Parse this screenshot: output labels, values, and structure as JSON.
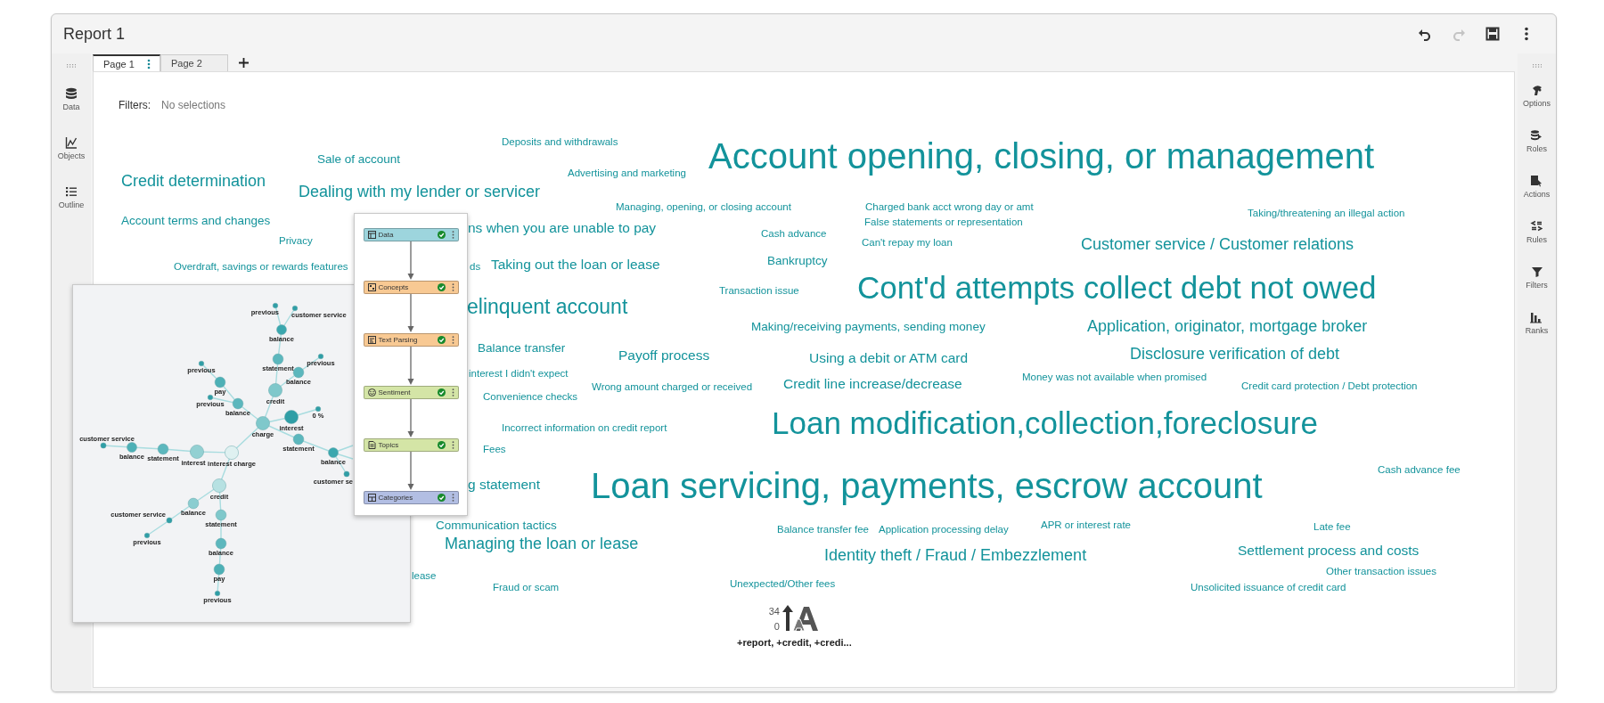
{
  "window": {
    "title": "Report 1"
  },
  "toolbar": [
    {
      "kind": "undo",
      "disabled": false
    },
    {
      "kind": "redo",
      "disabled": true
    },
    {
      "kind": "save",
      "disabled": false
    },
    {
      "kind": "more",
      "disabled": false
    }
  ],
  "left_sidebar": [
    {
      "kind": "data",
      "label": "Data"
    },
    {
      "kind": "objects",
      "label": "Objects"
    },
    {
      "kind": "outline",
      "label": "Outline"
    }
  ],
  "right_sidebar": [
    {
      "kind": "options",
      "label": "Options"
    },
    {
      "kind": "roles",
      "label": "Roles"
    },
    {
      "kind": "actions",
      "label": "Actions"
    },
    {
      "kind": "rules",
      "label": "Rules"
    },
    {
      "kind": "filters",
      "label": "Filters"
    },
    {
      "kind": "ranks",
      "label": "Ranks"
    }
  ],
  "tabs": [
    {
      "label": "Page 1",
      "selected": true
    },
    {
      "label": "Page 2",
      "selected": false
    }
  ],
  "filters": {
    "label": "Filters:",
    "value": "No selections"
  },
  "word_cloud": {
    "words": [
      {
        "text": "Deposits and withdrawals",
        "kind": "xs"
      },
      {
        "text": "Sale of account",
        "kind": "s"
      },
      {
        "text": "Advertising and marketing",
        "kind": "xs"
      },
      {
        "text": "Credit determination",
        "kind": "ml"
      },
      {
        "text": "Account opening, closing, or management",
        "kind": "xxl"
      },
      {
        "text": "Dealing with my lender or servicer",
        "kind": "ml"
      },
      {
        "text": "Managing, opening, or closing account",
        "kind": "xs"
      },
      {
        "text": "Charged bank acct wrong day or amt",
        "kind": "xs"
      },
      {
        "text": "Account terms and changes",
        "kind": "s"
      },
      {
        "text": "ns when you are unable to pay",
        "kind": "m"
      },
      {
        "text": "False statements or representation",
        "kind": "xs"
      },
      {
        "text": "Taking/threatening an illegal action",
        "kind": "xs"
      },
      {
        "text": "Privacy",
        "kind": "xs"
      },
      {
        "text": "Cash advance",
        "kind": "xs"
      },
      {
        "text": "Can't repay my loan",
        "kind": "xs"
      },
      {
        "text": "Customer service / Customer relations",
        "kind": "ml"
      },
      {
        "text": "Overdraft, savings or rewards features",
        "kind": "xs"
      },
      {
        "text": "ds",
        "kind": "xs"
      },
      {
        "text": "Taking out the loan or lease",
        "kind": "m"
      },
      {
        "text": "Bankruptcy",
        "kind": "s"
      },
      {
        "text": "Transaction issue",
        "kind": "xs"
      },
      {
        "text": "elinquent account",
        "kind": "l"
      },
      {
        "text": "Cont'd attempts collect debt not owed",
        "kind": "xl"
      },
      {
        "text": "Making/receiving payments, sending money",
        "kind": "s"
      },
      {
        "text": "Application, originator, mortgage broker",
        "kind": "ml"
      },
      {
        "text": "Balance transfer",
        "kind": "s"
      },
      {
        "text": "Payoff process",
        "kind": "m"
      },
      {
        "text": "Using a debit or ATM card",
        "kind": "m"
      },
      {
        "text": "Disclosure verification of debt",
        "kind": "ml"
      },
      {
        "text": "interest I didn't expect",
        "kind": "xs"
      },
      {
        "text": "Wrong amount charged or received",
        "kind": "xs"
      },
      {
        "text": "Credit line increase/decrease",
        "kind": "m"
      },
      {
        "text": "Money was not available when promised",
        "kind": "xs"
      },
      {
        "text": "Credit card protection / Debt protection",
        "kind": "xs"
      },
      {
        "text": "Convenience checks",
        "kind": "xs"
      },
      {
        "text": "Incorrect information on credit report",
        "kind": "xs"
      },
      {
        "text": "Loan modification,collection,foreclosure",
        "kind": "xl"
      },
      {
        "text": "Fees",
        "kind": "xs"
      },
      {
        "text": "g statement",
        "kind": "m"
      },
      {
        "text": "Loan servicing, payments, escrow account",
        "kind": "xxl"
      },
      {
        "text": "Cash advance fee",
        "kind": "xs"
      },
      {
        "text": "Communication tactics",
        "kind": "s"
      },
      {
        "text": "Balance transfer fee",
        "kind": "xs"
      },
      {
        "text": "Application processing delay",
        "kind": "xs"
      },
      {
        "text": "APR or interest rate",
        "kind": "xs"
      },
      {
        "text": "Late fee",
        "kind": "xs"
      },
      {
        "text": "Managing the loan or lease",
        "kind": "ml"
      },
      {
        "text": "Identity theft / Fraud / Embezzlement",
        "kind": "ml"
      },
      {
        "text": "Settlement process and costs",
        "kind": "m"
      },
      {
        "text": "lease",
        "kind": "xs"
      },
      {
        "text": "Fraud or scam",
        "kind": "xs"
      },
      {
        "text": "Unexpected/Other fees",
        "kind": "xs"
      },
      {
        "text": "Unsolicited issuance of credit card",
        "kind": "xs"
      },
      {
        "text": "Other transaction issues",
        "kind": "xs"
      }
    ],
    "legend": {
      "max": "34",
      "min": "0",
      "caption": "+report, +credit, +credi..."
    }
  },
  "graph": {
    "nodes": [
      {
        "label": "previous",
        "color": "#2f9ea6"
      },
      {
        "label": "customer service",
        "color": "#2f9ea6"
      },
      {
        "label": "balance",
        "color": "#3aa7ae"
      },
      {
        "label": "previous",
        "color": "#2f9ea6"
      },
      {
        "label": "statement",
        "color": "#5cb7bd"
      },
      {
        "label": "previous",
        "color": "#2f9ea6"
      },
      {
        "label": "balance",
        "color": "#5cb7bd"
      },
      {
        "label": "pay",
        "color": "#4db0b6"
      },
      {
        "label": "credit",
        "color": "#7fc8cb"
      },
      {
        "label": "previous",
        "color": "#2f9ea6"
      },
      {
        "label": "balance",
        "color": "#5cb7bd"
      },
      {
        "label": "0 %",
        "color": "#2f9ea6"
      },
      {
        "label": "interest",
        "color": "#2f9ea6"
      },
      {
        "label": "charge",
        "color": "#7fc8cb"
      },
      {
        "label": "statement",
        "color": "#5cb7bd"
      },
      {
        "label": "customer service",
        "color": "#2f9ea6"
      },
      {
        "label": "balance",
        "color": "#4db0b6"
      },
      {
        "label": "statement",
        "color": "#5cb7bd"
      },
      {
        "label": "interest",
        "color": "#93d0d2"
      },
      {
        "label": "interest charge",
        "color": "#dff1f1"
      },
      {
        "label": "balance",
        "color": "#3aa7ae"
      },
      {
        "label": "customer se",
        "color": "#2f9ea6"
      },
      {
        "label": "credit",
        "color": "#b7e1e2"
      },
      {
        "label": "balance",
        "color": "#8acdd0"
      },
      {
        "label": "statement",
        "color": "#7fc8cb"
      },
      {
        "label": "customer service",
        "color": "#2f9ea6"
      },
      {
        "label": "previous",
        "color": "#2f9ea6"
      },
      {
        "label": "balance",
        "color": "#5cb7bd"
      },
      {
        "label": "pay",
        "color": "#4db0b6"
      },
      {
        "label": "previous",
        "color": "#2f9ea6"
      }
    ]
  },
  "pipeline": {
    "nodes": [
      {
        "kind": "data",
        "label": "Data",
        "color": "#9dd5dd",
        "completed": true
      },
      {
        "kind": "concepts",
        "label": "Concepts",
        "color": "#f8c993",
        "completed": true
      },
      {
        "kind": "parsing",
        "label": "Text Parsing",
        "color": "#f8c993",
        "completed": true
      },
      {
        "kind": "sentiment",
        "label": "Sentiment",
        "color": "#d4e5a6",
        "completed": true
      },
      {
        "kind": "topics",
        "label": "Topics",
        "color": "#d4e5a6",
        "completed": true
      },
      {
        "kind": "categories",
        "label": "Categories",
        "color": "#b2bee3",
        "completed": true
      }
    ]
  }
}
